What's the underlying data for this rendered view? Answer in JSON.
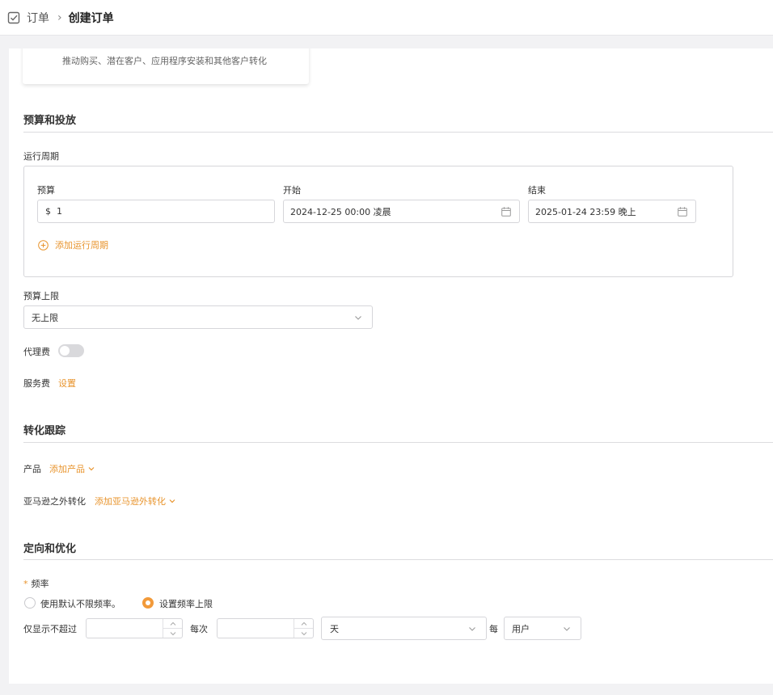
{
  "breadcrumb": {
    "root": "订单",
    "current": "创建订单"
  },
  "card_peek_text": "推动购买、潜在客户、应用程序安装和其他客户转化",
  "budget_section": {
    "title": "预算和投放",
    "run_period_label": "运行周期",
    "budget_label": "预算",
    "budget_currency": "$",
    "budget_value": "1",
    "start_label": "开始",
    "start_value": "2024-12-25 00:00 凌晨",
    "end_label": "结束",
    "end_value": "2025-01-24 23:59 晚上",
    "add_period": "添加运行周期",
    "budget_cap_label": "预算上限",
    "budget_cap_value": "无上限",
    "agency_fee_label": "代理费",
    "service_fee_label": "服务费",
    "service_fee_link": "设置"
  },
  "conversion_section": {
    "title": "转化跟踪",
    "product_label": "产品",
    "product_link": "添加产品",
    "offsite_label": "亚马逊之外转化",
    "offsite_link": "添加亚马逊外转化"
  },
  "targeting_section": {
    "title": "定向和优化",
    "frequency_label": "频率",
    "radio_default": "使用默认不限频率。",
    "radio_cap": "设置频率上限",
    "show_no_more": "仅显示不超过",
    "per_times": "每次",
    "period_unit": "天",
    "per": "每",
    "audience_unit": "用户"
  },
  "colors": {
    "accent": "#e8942d",
    "radio_checked": "#f29a3a",
    "border": "#d6d6da"
  }
}
